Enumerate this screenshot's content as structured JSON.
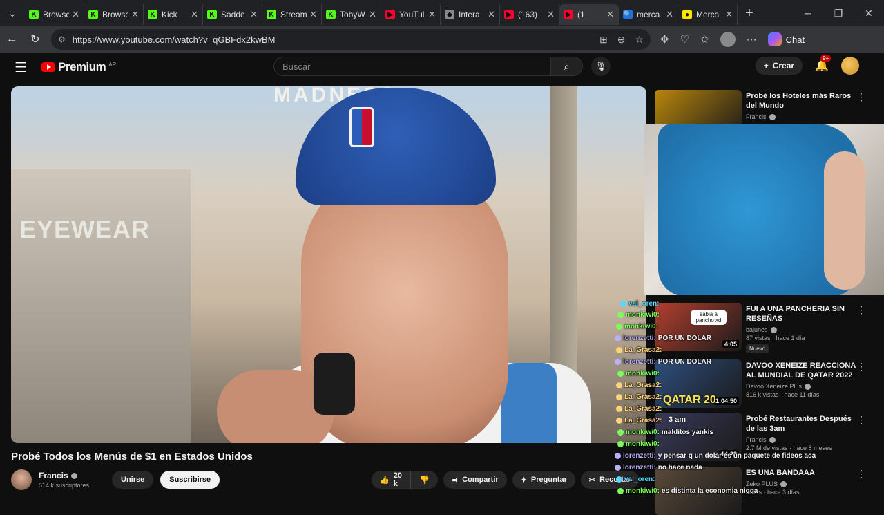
{
  "browser": {
    "tabs": [
      {
        "title": "Browse",
        "color": "#53fc18",
        "letter": "K"
      },
      {
        "title": "Browse",
        "color": "#53fc18",
        "letter": "K"
      },
      {
        "title": "Kick",
        "color": "#53fc18",
        "letter": "K"
      },
      {
        "title": "Sadde",
        "color": "#53fc18",
        "letter": "K"
      },
      {
        "title": "Stream",
        "color": "#53fc18",
        "letter": "K"
      },
      {
        "title": "TobyW",
        "color": "#53fc18",
        "letter": "K"
      },
      {
        "title": "YouTul",
        "color": "#ff0033",
        "letter": "▶"
      },
      {
        "title": "Intera",
        "color": "#888888",
        "letter": "◆"
      },
      {
        "title": "(163)",
        "color": "#ff0033",
        "letter": "▶"
      },
      {
        "title": "(1",
        "color": "#ff0033",
        "letter": "▶"
      },
      {
        "title": "merca",
        "color": "#1a73e8",
        "letter": "🔍"
      },
      {
        "title": "Merca",
        "color": "#ffe600",
        "letter": "●"
      }
    ],
    "active_tab": 9,
    "url": "https://www.youtube.com/watch?v=qGBFdx2kwBM",
    "chat_label": "Chat"
  },
  "youtube": {
    "brand": "Premium",
    "region": "AR",
    "search_placeholder": "Buscar",
    "create_label": "Crear",
    "notif_badge": "9+"
  },
  "video": {
    "title": "Probé Todos los Menús de $1 en Estados Unidos",
    "store_sign": "EYEWEAR",
    "store_top": "MADNESS",
    "channel": "Francis",
    "subscribers": "514 k suscriptores",
    "join_label": "Unirse",
    "subscribe_label": "Suscribirse",
    "likes": "20 k",
    "share_label": "Compartir",
    "ask_label": "Preguntar",
    "clip_label": "Recortar"
  },
  "recommendations": [
    {
      "title": "Probé los Hoteles más Raros del Mundo",
      "channel": "Francis",
      "views": "",
      "duration": "",
      "thumb": "#b8860b",
      "new": false
    },
    {
      "title": "FUI A UNA PANCHERIA SIN RESEÑAS",
      "channel": "bajunes",
      "views": "87 vistas · hace 1 día",
      "duration": "4:05",
      "thumb": "#b43f2f",
      "new": true,
      "new_label": "Nuevo"
    },
    {
      "title": "DAVOO XENEIZE REACCIONA AL MUNDIAL DE QATAR 2022 ...",
      "channel": "Davoo Xeneize Plus",
      "views": "816 k vistas · hace 11 días",
      "duration": "1:04:50",
      "thumb": "#2f4f7f",
      "new": false
    },
    {
      "title": "Probé Restaurantes Después de las 3am",
      "channel": "Francis",
      "views": "2.7 M de vistas · hace 8 meses",
      "duration": "14:23",
      "thumb": "#3a3a5a",
      "new": false
    },
    {
      "title": "ES UNA BANDAAA",
      "channel": "Zeko PLUS",
      "views": "vistas · hace 3 días",
      "duration": "",
      "thumb": "#5a4a3a",
      "new": false
    }
  ],
  "chat_overlay": [
    {
      "user": "val_oren:",
      "msg": "",
      "color": "#5bd6ff"
    },
    {
      "user": "monkiwi0:",
      "msg": "",
      "color": "#7cff5b"
    },
    {
      "user": "monkiwi0:",
      "msg": "",
      "color": "#7cff5b"
    },
    {
      "user": "lorenzetti:",
      "msg": "POR UN DOLAR",
      "color": "#b8b0ff"
    },
    {
      "user": "La_Grasa2:",
      "msg": "",
      "color": "#ffd37a"
    },
    {
      "user": "lorenzetti:",
      "msg": "POR UN DOLAR",
      "color": "#b8b0ff"
    },
    {
      "user": "monkiwi0:",
      "msg": "",
      "color": "#7cff5b"
    },
    {
      "user": "La_Grasa2:",
      "msg": "",
      "color": "#ffd37a"
    },
    {
      "user": "La_Grasa2:",
      "msg": "",
      "color": "#ffd37a"
    },
    {
      "user": "La_Grasa2:",
      "msg": "",
      "color": "#ffd37a"
    },
    {
      "user": "La_Grasa2:",
      "msg": "",
      "color": "#ffd37a"
    },
    {
      "user": "monkiwi0:",
      "msg": "malditos yankis",
      "color": "#7cff5b"
    },
    {
      "user": "monkiwi0:",
      "msg": "",
      "color": "#7cff5b"
    },
    {
      "user": "lorenzetti:",
      "msg": "y pensar q un dolar es un paquete de fideos aca",
      "color": "#b8b0ff"
    },
    {
      "user": "lorenzetti:",
      "msg": "no hace nada",
      "color": "#b8b0ff"
    },
    {
      "user": "val_oren:",
      "msg": "",
      "color": "#5bd6ff"
    },
    {
      "user": "monkiwi0:",
      "msg": "es distinta la economia nigga",
      "color": "#7cff5b"
    }
  ],
  "chat_sticker": "sabia a pancho xd",
  "rec_thumb_text": {
    "qatar": "QATAR 20",
    "time": "3 am"
  }
}
